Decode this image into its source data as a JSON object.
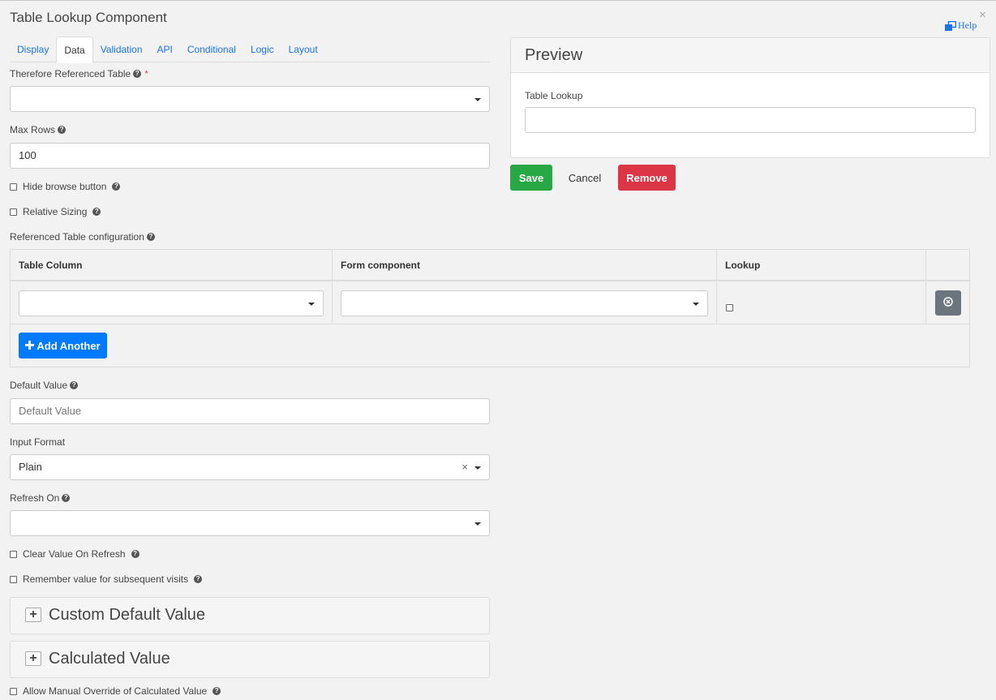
{
  "dialog": {
    "title": "Table Lookup Component",
    "close_symbol": "×",
    "help_label": "Help",
    "help_icon": "external-window-icon"
  },
  "tabs": [
    {
      "label": "Display",
      "active": false
    },
    {
      "label": "Data",
      "active": true
    },
    {
      "label": "Validation",
      "active": false
    },
    {
      "label": "API",
      "active": false
    },
    {
      "label": "Conditional",
      "active": false
    },
    {
      "label": "Logic",
      "active": false
    },
    {
      "label": "Layout",
      "active": false
    }
  ],
  "form": {
    "referenced_table": {
      "label": "Therefore Referenced Table",
      "required_mark": "*",
      "value": ""
    },
    "max_rows": {
      "label": "Max Rows",
      "value": "100"
    },
    "hide_browse": {
      "label": "Hide browse button",
      "checked": false
    },
    "relative_sizing": {
      "label": "Relative Sizing",
      "checked": false
    },
    "table_config": {
      "label": "Referenced Table configuration",
      "columns": [
        "Table Column",
        "Form component",
        "Lookup"
      ],
      "add_label": "Add Another"
    },
    "default_value": {
      "label": "Default Value",
      "placeholder": "Default Value"
    },
    "input_format": {
      "label": "Input Format",
      "value": "Plain",
      "clear_symbol": "×"
    },
    "refresh_on": {
      "label": "Refresh On",
      "value": ""
    },
    "clear_on_refresh": {
      "label": "Clear Value On Refresh",
      "checked": false
    },
    "remember_value": {
      "label": "Remember value for subsequent visits",
      "checked": false
    },
    "custom_default": {
      "title": "Custom Default Value",
      "expand_symbol": "+"
    },
    "calculated_value": {
      "title": "Calculated Value",
      "expand_symbol": "+"
    },
    "manual_override": {
      "label": "Allow Manual Override of Calculated Value",
      "checked": false
    }
  },
  "preview": {
    "title": "Preview",
    "field_label": "Table Lookup"
  },
  "actions": {
    "save": "Save",
    "cancel": "Cancel",
    "remove": "Remove"
  },
  "colors": {
    "save": "#28a745",
    "remove": "#dc3545",
    "primary": "#007bff",
    "link": "#1a73e8"
  }
}
